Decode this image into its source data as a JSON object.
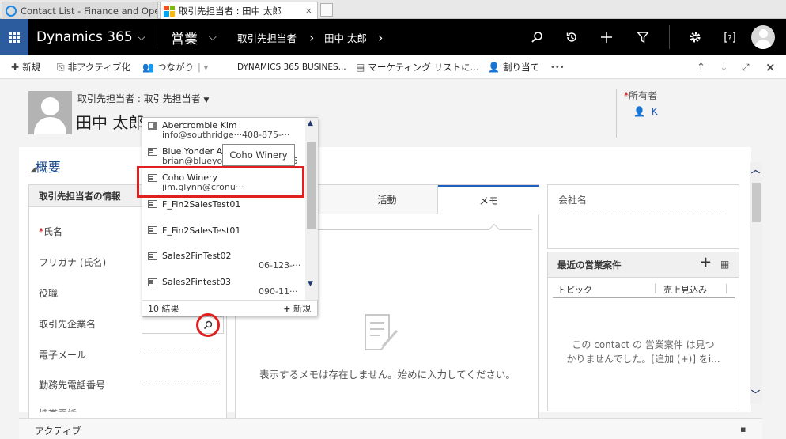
{
  "browser": {
    "tab1_title": "Contact List - Finance and Ope...",
    "tab2_title": "取引先担当者 : 田中 太郎",
    "close_glyph": "×"
  },
  "nav": {
    "app_name": "Dynamics 365",
    "area": "営業",
    "breadcrumb1": "取引先担当者",
    "breadcrumb2": "田中 太郎",
    "chevron": "⌵",
    "arrow": "›"
  },
  "commands": {
    "new": "新規",
    "deactivate": "非アクティブ化",
    "connect": "つながり",
    "business": "DYNAMICS 365 BUSINES...",
    "marketing": "マーケティング リストに...",
    "assign": "割り当て",
    "more": "•••"
  },
  "header": {
    "entity_selector": "取引先担当者 : 取引先担当者",
    "contact_name": "田中 太郎",
    "owner_label": "所有者",
    "owner_value": "K",
    "required_mark": "*"
  },
  "section": {
    "title": "概要",
    "collapse_glyph": "◢"
  },
  "contact_info": {
    "header": "取引先担当者の情報",
    "fields": [
      "氏名",
      "フリガナ (氏名)",
      "役職",
      "取引先企業名",
      "電子メール",
      "勤務先電話番号"
    ],
    "partial_field": "携帯電話"
  },
  "tabs": {
    "activities": "活動",
    "notes": "メモ"
  },
  "notes_empty_message": "表示するメモは存在しません。始めに入力してください。",
  "right": {
    "company_label": "会社名",
    "opportunities_title": "最近の営業案件",
    "col_topic": "トピック",
    "col_revenue": "売上見込み",
    "empty_line1": "この contact の 営業案件 は見つ",
    "empty_line2": "かりませんでした。[追加 (+)] をi..."
  },
  "lookup": {
    "items": [
      {
        "name": "Abercrombie Kim",
        "email": "info@southridge···",
        "phone": "408-875-···",
        "kind": "contact"
      },
      {
        "name": "Blue Yonder Ai",
        "email": "brian@blueyon",
        "phone": "5",
        "kind": "account"
      },
      {
        "name": "Coho Winery",
        "email": "jim.glynn@cronu···",
        "phone": "",
        "kind": "account"
      },
      {
        "name": "F_Fin2SalesTest01",
        "email": "",
        "phone": "",
        "kind": "account"
      },
      {
        "name": "F_Fin2SalesTest01",
        "email": "",
        "phone": "",
        "kind": "account"
      },
      {
        "name": "Sales2FinTest02",
        "email": "",
        "phone": "06-123-···",
        "kind": "account"
      },
      {
        "name": "Sales2Fintest03",
        "email": "",
        "phone": "090-11···",
        "kind": "account"
      }
    ],
    "results_count": "10 結果",
    "new_label": "新規",
    "tooltip": "Coho Winery"
  },
  "footer": {
    "status": "アクティブ"
  },
  "colors": {
    "nav_bg": "#000000",
    "waffle_bg": "#2d5c9e",
    "highlight_red": "#e02020",
    "link_blue": "#1f4e8c"
  }
}
